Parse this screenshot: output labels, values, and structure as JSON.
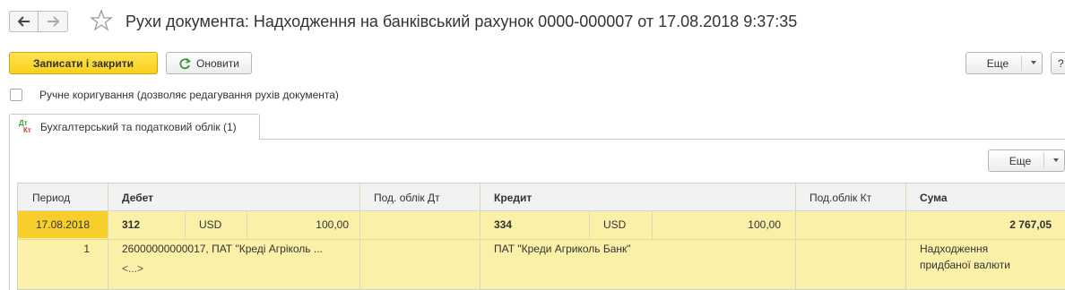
{
  "window": {
    "title": "Рухи документа: Надходження на банківський рахунок 0000-000007 от 17.08.2018 9:37:35"
  },
  "toolbar": {
    "save_close_label": "Записати і закрити",
    "refresh_label": "Оновити",
    "more_label": "Еще",
    "help_label": "?"
  },
  "manual_edit": {
    "label": "Ручне коригування (дозволяє редагування рухів документа)",
    "checked": false
  },
  "tabs": [
    {
      "label": "Бухгалтерський та податковий облік (1)",
      "icon": "dt-kt-icon",
      "active": true
    }
  ],
  "grid": {
    "more_label": "Еще",
    "columns": [
      "Период",
      "Дебет",
      "Под. облік Дт",
      "Кредит",
      "Под.облік Кт",
      "Сума"
    ],
    "rows": [
      {
        "period": "17.08.2018",
        "line_no": "1",
        "debit_account": "312",
        "debit_currency": "USD",
        "debit_amount": "100,00",
        "debit_subconto1": "26000000000017, ПАТ \"Креді Агріколь ...",
        "debit_subconto2": "<...>",
        "credit_account": "334",
        "credit_currency": "USD",
        "credit_amount": "100,00",
        "credit_subconto1": "ПАТ \"Креди Агриколь Банк\"",
        "sum": "2 767,05",
        "content_line1": "Надходження",
        "content_line2": "придбаної валюти"
      }
    ]
  },
  "colors": {
    "primary_button": "#f8cf1c",
    "row_bg": "#fbf0a8",
    "selected_cell": "#f7cf2a",
    "refresh_icon": "#2e9a2e"
  }
}
